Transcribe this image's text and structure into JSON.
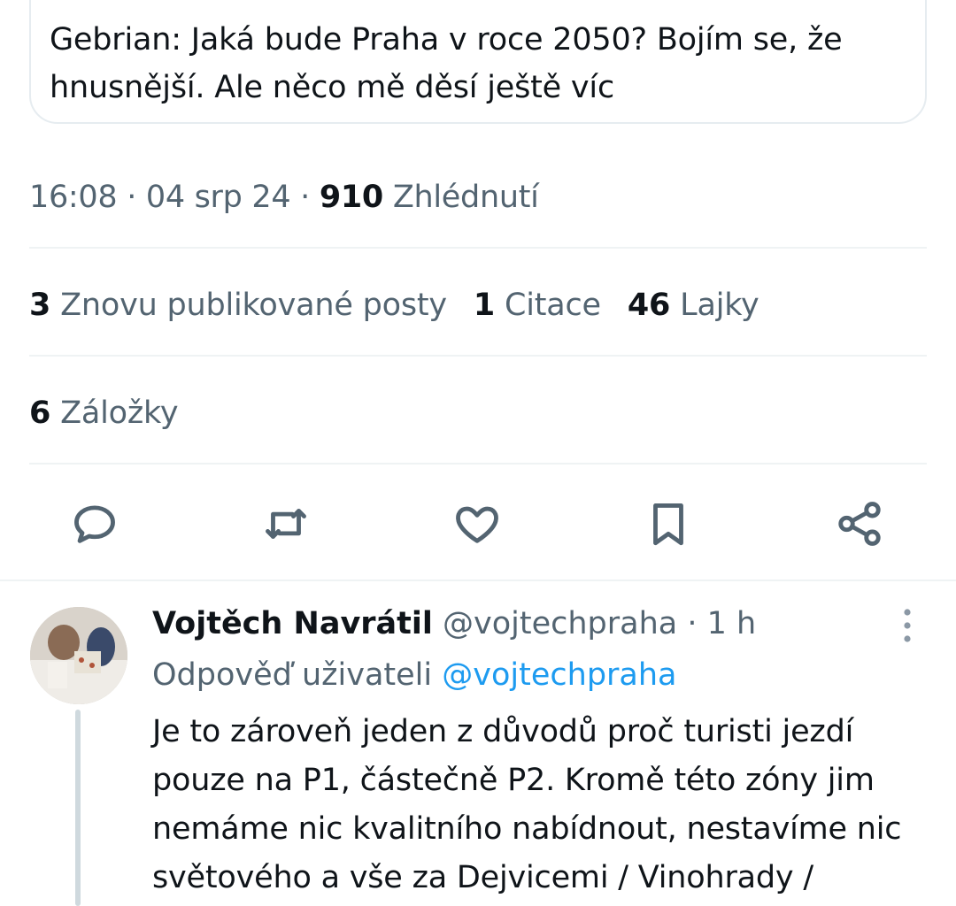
{
  "quoted_post": {
    "text": "Gebrian: Jaká bude Praha v roce 2050? Bojím se, že hnusnější. Ale něco mě děsí ještě víc"
  },
  "post_meta": {
    "time": "16:08",
    "separator": " · ",
    "date": "04 srp 24",
    "views_count": "910",
    "views_label": "Zhlédnutí"
  },
  "stats": {
    "reposts_count": "3",
    "reposts_label": "Znovu publikované posty",
    "quotes_count": "1",
    "quotes_label": "Citace",
    "likes_count": "46",
    "likes_label": "Lajky",
    "bookmarks_count": "6",
    "bookmarks_label": "Záložky"
  },
  "actions": {
    "reply_icon": "reply-icon",
    "repost_icon": "repost-icon",
    "like_icon": "heart-icon",
    "bookmark_icon": "bookmark-icon",
    "share_icon": "share-icon"
  },
  "reply": {
    "author_name": "Vojtěch Navrátil",
    "handle": "@vojtechpraha",
    "time": " · 1 h",
    "reply_to_label": "Odpověď uživateli",
    "reply_to_handle": "@vojtechpraha",
    "text": "Je to zároveň jeden z důvodů proč turisti jezdí pouze na P1, částečně P2. Kromě této zóny jim nemáme nic kvalitního nabídnout, nestavíme nic světového a vše za Dejvicemi / Vinohrady /"
  },
  "colors": {
    "text_primary": "#0f1419",
    "text_secondary": "#536471",
    "accent": "#1d9bf0",
    "divider": "#eff3f4"
  }
}
